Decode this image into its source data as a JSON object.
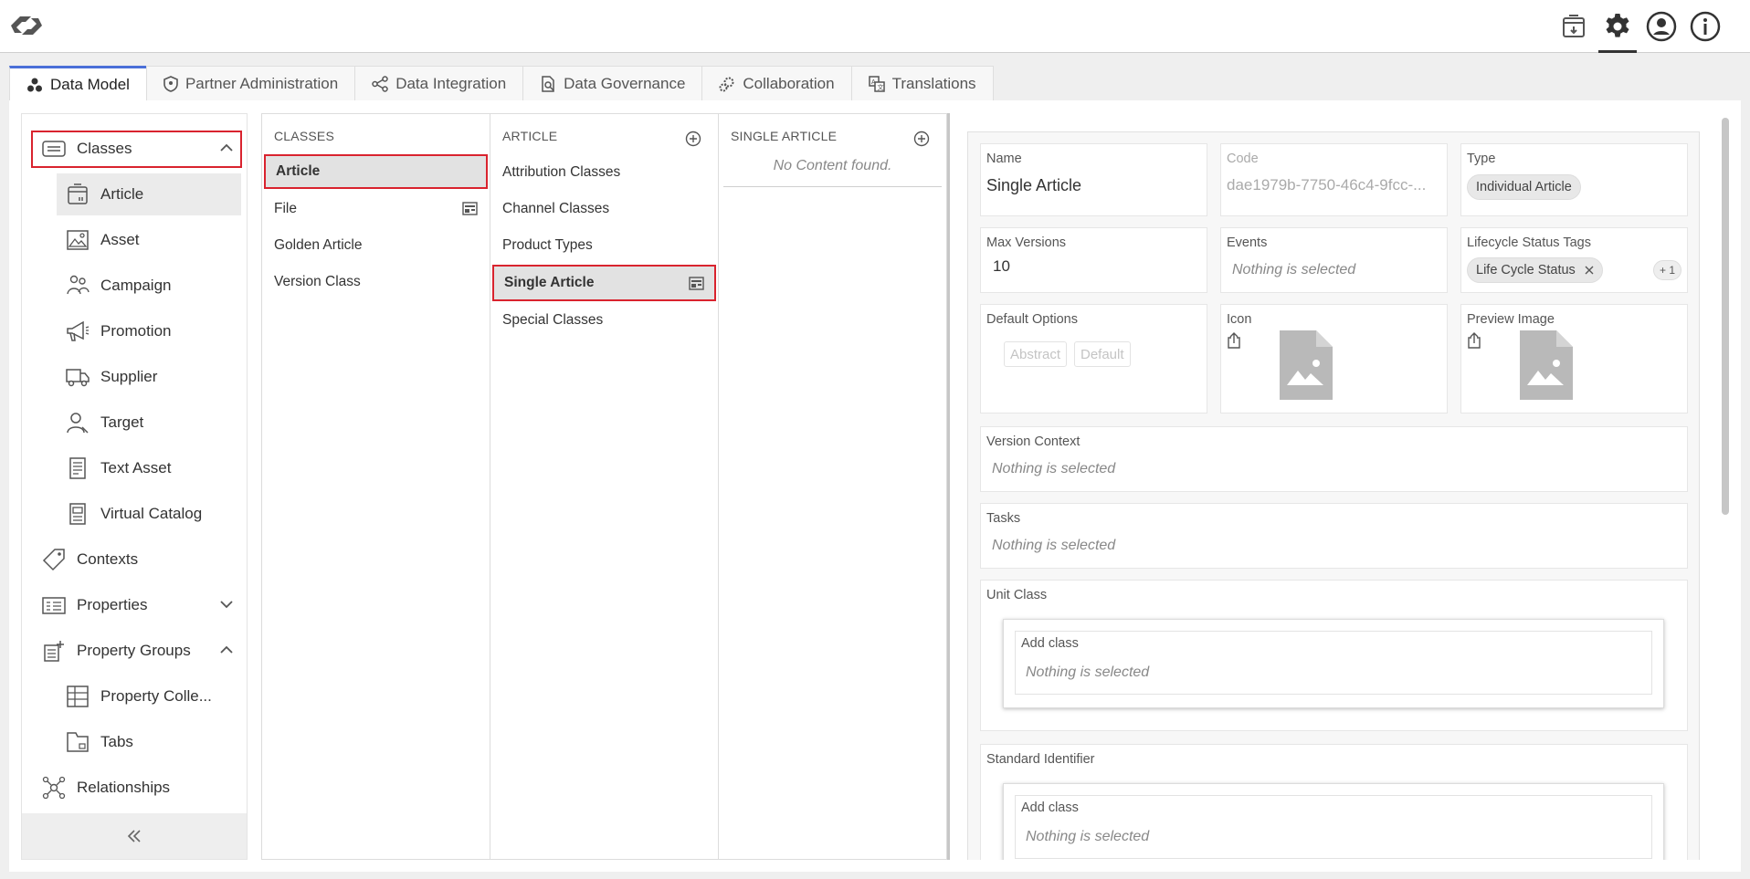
{
  "app": {
    "logo": "stibo-logo"
  },
  "topbar": {
    "icons": [
      "archive-icon",
      "gear-icon",
      "user-icon",
      "info-icon"
    ]
  },
  "tabs": [
    {
      "label": "Data Model",
      "icon": "data-model-icon",
      "active": true
    },
    {
      "label": "Partner Administration",
      "icon": "shield-icon"
    },
    {
      "label": "Data Integration",
      "icon": "share-nodes-icon"
    },
    {
      "label": "Data Governance",
      "icon": "governance-icon"
    },
    {
      "label": "Collaboration",
      "icon": "gears-icon"
    },
    {
      "label": "Translations",
      "icon": "translate-icon"
    }
  ],
  "sidebar": {
    "classes": "Classes",
    "sub_classes": [
      "Article",
      "Asset",
      "Campaign",
      "Promotion",
      "Supplier",
      "Target",
      "Text Asset",
      "Virtual Catalog"
    ],
    "contexts": "Contexts",
    "properties": "Properties",
    "property_groups": "Property Groups",
    "sub_property_groups": [
      "Property Colle...",
      "Tabs"
    ],
    "relationships": "Relationships",
    "collapse_icon": "double-chevron-left-icon"
  },
  "columns": {
    "classes": {
      "header": "CLASSES",
      "items": [
        "Article",
        "File",
        "Golden Article",
        "Version Class"
      ]
    },
    "article": {
      "header": "ARTICLE",
      "items": [
        "Attribution Classes",
        "Channel Classes",
        "Product Types",
        "Single Article",
        "Special Classes"
      ]
    },
    "single_article": {
      "header": "SINGLE ARTICLE",
      "empty": "No Content found."
    }
  },
  "detail": {
    "name_label": "Name",
    "name_value": "Single Article",
    "code_label": "Code",
    "code_value": "dae1979b-7750-46c4-9fcc-...",
    "type_label": "Type",
    "type_value": "Individual Article",
    "max_versions_label": "Max Versions",
    "max_versions_value": "10",
    "events_label": "Events",
    "events_placeholder": "Nothing is selected",
    "lifecycle_label": "Lifecycle Status Tags",
    "lifecycle_chip": "Life Cycle Status",
    "lifecycle_more": "+ 1",
    "default_options_label": "Default Options",
    "default_options": [
      "Abstract",
      "Default"
    ],
    "icon_label": "Icon",
    "preview_image_label": "Preview Image",
    "version_context_label": "Version Context",
    "version_context_placeholder": "Nothing is selected",
    "tasks_label": "Tasks",
    "tasks_placeholder": "Nothing is selected",
    "unit_class_label": "Unit Class",
    "unit_class_add": "Add class",
    "unit_class_placeholder": "Nothing is selected",
    "standard_identifier_label": "Standard Identifier",
    "standard_identifier_add": "Add class",
    "standard_identifier_placeholder": "Nothing is selected"
  },
  "colors": {
    "highlight": "#d9232e",
    "tab_accent": "#4a6fd8"
  }
}
